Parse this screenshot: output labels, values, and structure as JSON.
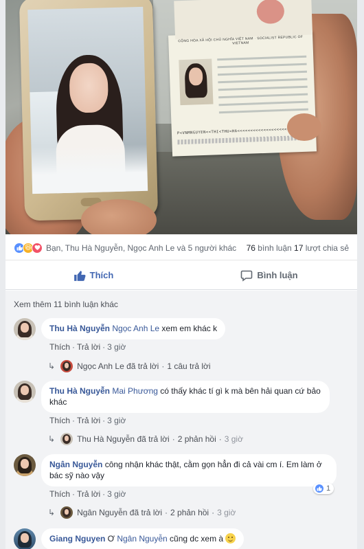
{
  "reactions": {
    "names": "Bạn, Thu Hà Nguyễn, Ngọc Anh Le và 5 người khác",
    "comments_count": "76",
    "comments_label": "bình luận",
    "shares_count": "17",
    "shares_label": "lượt chia sẻ"
  },
  "actions": {
    "like": "Thích",
    "comment": "Bình luận"
  },
  "passport": {
    "header": "CỘNG HÒA XÃ HỘI CHỦ NGHĨA VIỆT NAM · SOCIALIST REPUBLIC OF VIETNAM",
    "mrz": "P<VNMNGUYEN<<THI<THU<HA<<<<<<<<<<<<<<<<<<<<<"
  },
  "comments": {
    "more": "Xem thêm 11 bình luận khác",
    "items": [
      {
        "author": "Thu Hà Nguyễn",
        "tag": "Ngọc Anh Le",
        "text": " xem em khác k",
        "like": "Thích",
        "reply": "Trả lời",
        "time": "3 giờ",
        "reply_author": "Ngọc Anh Le",
        "reply_text": "đã trả lời",
        "reply_count": "1 câu trả lời",
        "reply_time": ""
      },
      {
        "author": "Thu Hà Nguyễn",
        "tag": "Mai Phương",
        "text": " có thấy khác tí gì k mà bên hải quan cứ bảo khác",
        "like": "Thích",
        "reply": "Trả lời",
        "time": "3 giờ",
        "reply_author": "Thu Hà Nguyễn",
        "reply_text": "đã trả lời",
        "reply_count": "2 phản hồi",
        "reply_time": "3 giờ"
      },
      {
        "author": "Ngân Nguyễn",
        "tag": "",
        "text": "công nhận khác thật, cằm gọn hẳn đi cả vài cm í. Em làm ở bác sỹ nào vậy",
        "like": "Thích",
        "reply": "Trả lời",
        "time": "3 giờ",
        "likes": "1",
        "reply_author": "Ngân Nguyễn",
        "reply_text": "đã trả lời",
        "reply_count": "2 phản hồi",
        "reply_time": "3 giờ"
      },
      {
        "author": "Giang Nguyen",
        "prefix": " Ơ ",
        "tag": "Ngân Nguyễn",
        "text": " cũng dc xem à "
      }
    ]
  }
}
